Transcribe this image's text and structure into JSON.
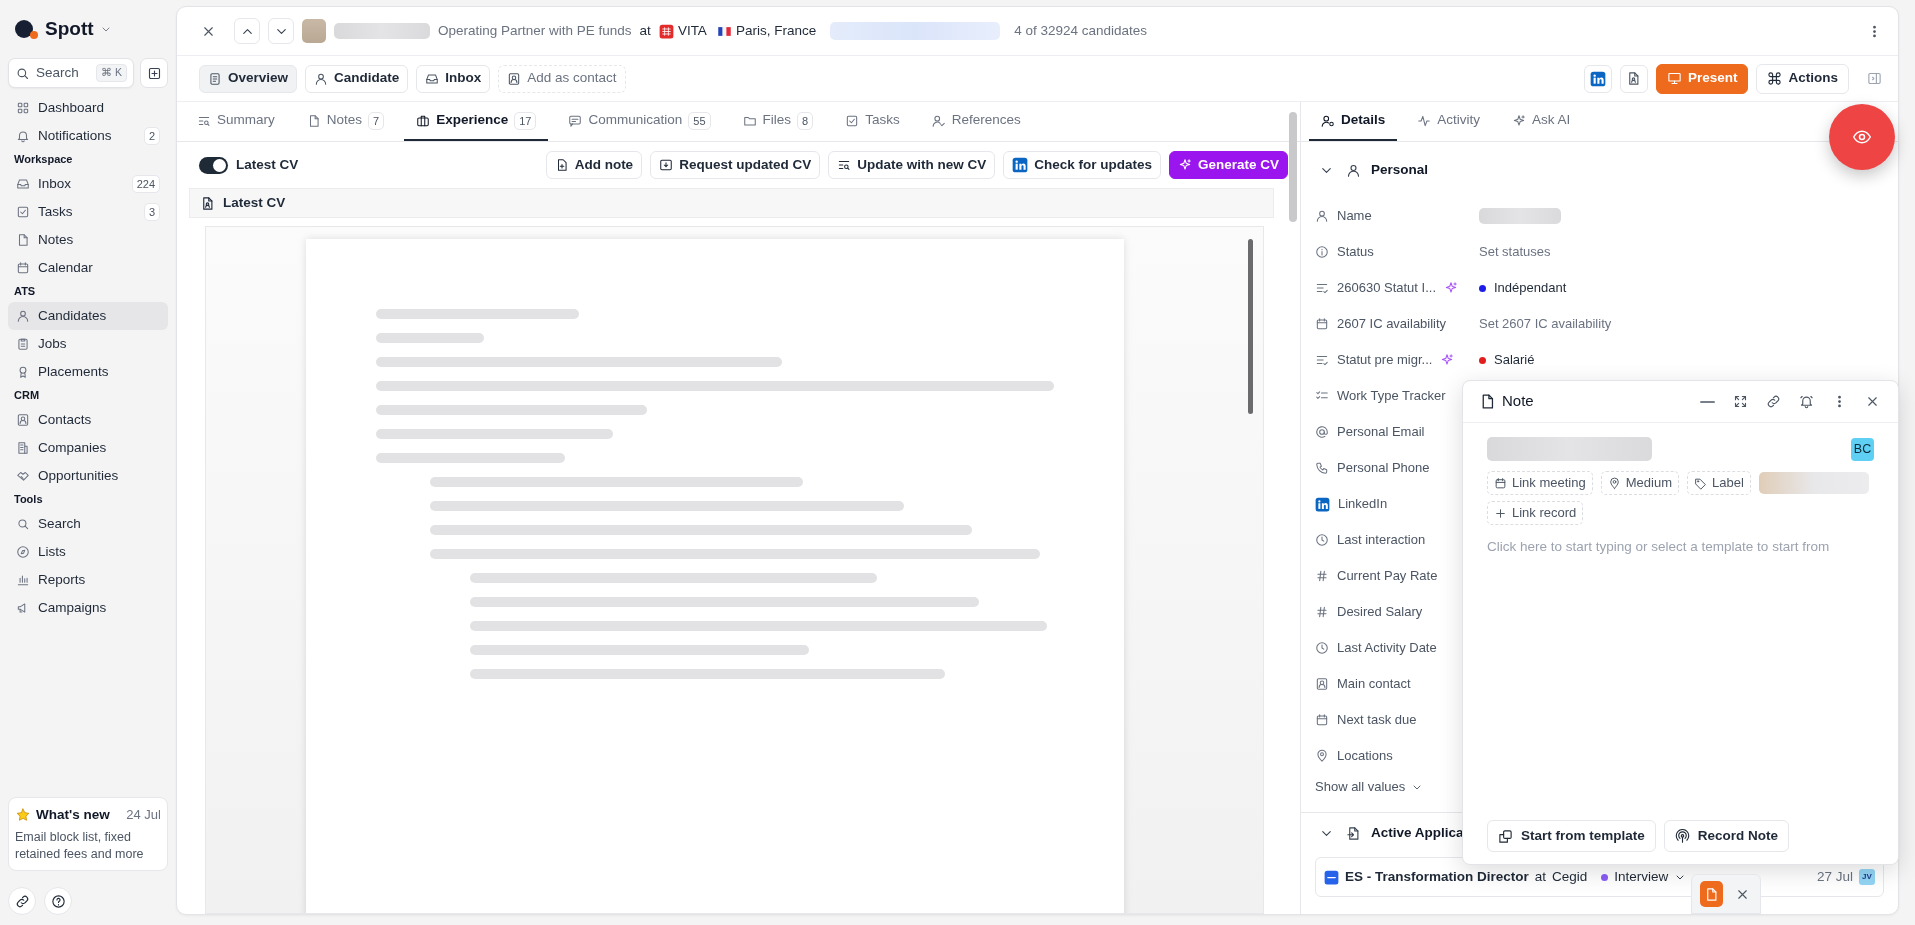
{
  "sidebar": {
    "brand": "Spott",
    "search": {
      "placeholder": "Search",
      "shortcut": "⌘ K"
    },
    "sections": [
      {
        "items": [
          {
            "label": "Dashboard",
            "selected": false
          },
          {
            "label": "Notifications",
            "count": "2",
            "selected": false
          }
        ]
      },
      {
        "heading": "Workspace",
        "items": [
          {
            "label": "Inbox",
            "count": "224",
            "selected": false
          },
          {
            "label": "Tasks",
            "count": "3",
            "selected": false
          },
          {
            "label": "Notes",
            "selected": false
          },
          {
            "label": "Calendar",
            "selected": false
          }
        ]
      },
      {
        "heading": "ATS",
        "items": [
          {
            "label": "Candidates",
            "selected": true
          },
          {
            "label": "Jobs",
            "selected": false
          },
          {
            "label": "Placements",
            "selected": false
          }
        ]
      },
      {
        "heading": "CRM",
        "items": [
          {
            "label": "Contacts",
            "selected": false
          },
          {
            "label": "Companies",
            "selected": false
          },
          {
            "label": "Opportunities",
            "selected": false
          }
        ]
      },
      {
        "heading": "Tools",
        "items": [
          {
            "label": "Search",
            "selected": false
          },
          {
            "label": "Lists",
            "selected": false
          },
          {
            "label": "Reports",
            "selected": false
          },
          {
            "label": "Campaigns",
            "selected": false
          }
        ]
      }
    ],
    "whats_new": {
      "title": "What's new",
      "date": "24 Jul",
      "text": "Email block list, fixed retained fees and more"
    }
  },
  "header": {
    "position": "Operating Partner with PE funds",
    "connector": "at",
    "company": "VITA",
    "location": "Paris, France",
    "counter": "4 of 32924 candidates"
  },
  "view_buttons": [
    {
      "label": "Overview",
      "kind": "solid",
      "selected": true
    },
    {
      "label": "Candidate",
      "kind": "solid",
      "selected": false
    },
    {
      "label": "Inbox",
      "kind": "solid",
      "selected": false
    },
    {
      "label": "Add as contact",
      "kind": "dashed",
      "selected": false
    }
  ],
  "header_actions": [
    {
      "label": "Present",
      "kind": "accent"
    },
    {
      "label": "Actions",
      "kind": "default"
    }
  ],
  "tabs": [
    {
      "label": "Summary",
      "selected": false
    },
    {
      "label": "Notes",
      "count": "7",
      "selected": false
    },
    {
      "label": "Experience",
      "count": "17",
      "selected": true
    },
    {
      "label": "Communication",
      "count": "55",
      "selected": false
    },
    {
      "label": "Files",
      "count": "8",
      "selected": false
    },
    {
      "label": "Tasks",
      "selected": false
    },
    {
      "label": "References",
      "selected": false
    }
  ],
  "cv_toggle": {
    "label": "Latest CV",
    "on": true
  },
  "cv_buttons": [
    {
      "label": "Add note",
      "kind": "default"
    },
    {
      "label": "Request updated CV",
      "kind": "default"
    },
    {
      "label": "Update with new CV",
      "kind": "default"
    },
    {
      "label": "Check for updates",
      "kind": "default"
    },
    {
      "label": "Generate CV",
      "kind": "primary"
    }
  ],
  "cv_panel": {
    "title": "Latest CV"
  },
  "details_tabs": [
    {
      "label": "Details",
      "selected": true
    },
    {
      "label": "Activity",
      "selected": false
    },
    {
      "label": "Ask AI",
      "selected": false
    }
  ],
  "personal": {
    "title": "Personal",
    "expanded": true,
    "fields": [
      {
        "label": "Name",
        "kind": "redacted",
        "ai": false
      },
      {
        "label": "Status",
        "kind": "placeholder",
        "value": "Set statuses",
        "ai": false
      },
      {
        "label": "260630 Statut I...",
        "kind": "status",
        "value": "Indépendant",
        "color": "#1d1dea",
        "ai": true
      },
      {
        "label": "2607 IC availability",
        "kind": "placeholder",
        "value": "Set 2607 IC availability",
        "ai": false
      },
      {
        "label": "Statut pre migr...",
        "kind": "status",
        "value": "Salarié",
        "color": "#e11d1d",
        "ai": true
      },
      {
        "label": "Work Type Tracker",
        "kind": "blank",
        "ai": false
      },
      {
        "label": "Personal Email",
        "kind": "blank",
        "ai": false
      },
      {
        "label": "Personal Phone",
        "kind": "blank",
        "ai": false
      },
      {
        "label": "LinkedIn",
        "kind": "blank",
        "ai": false
      },
      {
        "label": "Last interaction",
        "kind": "blank",
        "ai": false
      },
      {
        "label": "Current Pay Rate",
        "kind": "blank",
        "ai": false
      },
      {
        "label": "Desired Salary",
        "kind": "blank",
        "ai": false
      },
      {
        "label": "Last Activity Date",
        "kind": "blank",
        "ai": false
      },
      {
        "label": "Main contact",
        "kind": "blank",
        "ai": false
      },
      {
        "label": "Next task due",
        "kind": "blank",
        "ai": false
      },
      {
        "label": "Locations",
        "kind": "blank",
        "ai": false
      }
    ],
    "show_all": "Show all values"
  },
  "applications": {
    "title": "Active Applica",
    "expanded": true,
    "items": [
      {
        "title": "ES - Transformation Director",
        "connector": "at",
        "company": "Cegid",
        "stage": "Interview",
        "color": "#8b5cf6",
        "date": "27 Jul",
        "owner": "JV"
      }
    ]
  },
  "note": {
    "title": "Note",
    "avatar": "BC",
    "chips": [
      {
        "label": "Link meeting"
      },
      {
        "label": "Medium"
      },
      {
        "label": "Label"
      },
      {
        "label": "Link record"
      }
    ],
    "placeholder": "Click here to start typing or select a template to start from",
    "buttons": [
      "Start from template",
      "Record Note"
    ]
  }
}
